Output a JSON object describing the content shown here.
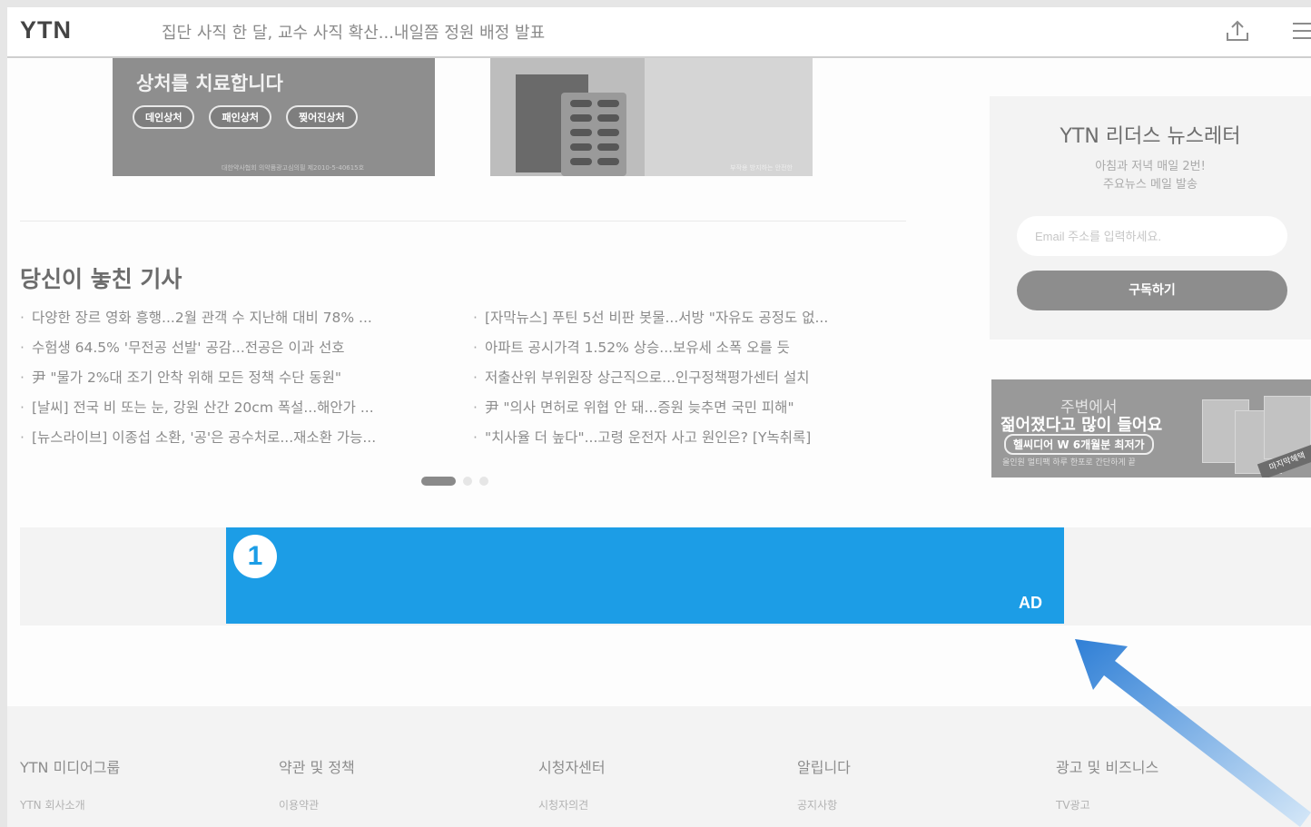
{
  "header": {
    "logo": "YTN",
    "headline": "집단 사직 한 달, 교수 사직 확산...내일쯤 정원 배정 발표",
    "share_icon": "share-upload-icon",
    "menu_icon": "hamburger-menu-icon"
  },
  "banner1": {
    "line1": "상처를 치료합니다",
    "pills": [
      "데인상처",
      "패인상처",
      "찢어진상처"
    ],
    "fine": "대한약사협회 의약품광고심의필 제2010-5-40615호"
  },
  "banner2": {
    "fine": "부작용 방지하는 안전한"
  },
  "missed": {
    "title": "당신이 놓친 기사",
    "left": [
      "다양한 장르 영화 흥행...2월 관객 수 지난해 대비 78% ...",
      "수험생 64.5% '무전공 선발' 공감...전공은 이과 선호",
      "尹 \"물가 2%대 조기 안착 위해 모든 정책 수단 동원\"",
      "[날씨] 전국 비 또는 눈, 강원 산간 20cm 폭설...해안가 ...",
      "[뉴스라이브] 이종섭 소환, '공'은 공수처로...재소환 가능..."
    ],
    "right": [
      "[자막뉴스] 푸틴 5선 비판 봇물...서방 \"자유도 공정도 없...",
      "아파트 공시가격 1.52% 상승...보유세 소폭 오를 듯",
      "저출산위 부위원장 상근직으로...인구정책평가센터 설치",
      "尹 \"의사 면허로 위협 안 돼...증원 늦추면 국민 피해\"",
      "\"치사율 더 높다\"...고령 운전자 사고 원인은? [Y녹취록]"
    ],
    "pager_active": 1,
    "pager_total": 3
  },
  "newsletter": {
    "title": "YTN 리더스 뉴스레터",
    "desc1": "아침과 저녁 매일 2번!",
    "desc2": "주요뉴스 메일 발송",
    "email_placeholder": "Email 주소를 입력하세요.",
    "subscribe_label": "구독하기"
  },
  "side_ad": {
    "line1": "주변에서",
    "line2": "젊어졌다고 많이 들어요",
    "line3": "헬씨디어 W 6개월분 최저가",
    "line4": "올인원 멀티팩 하루 한포로 간단하게 끝",
    "tag": "마지막혜택"
  },
  "ad_slot": {
    "badge": "1",
    "label": "AD"
  },
  "colors": {
    "ad_highlight": "#1c9de6",
    "arrow": "#2f7fd6"
  },
  "footer": {
    "columns": [
      {
        "title": "YTN 미디어그룹",
        "link": "YTN 회사소개"
      },
      {
        "title": "약관 및 정책",
        "link": "이용약관"
      },
      {
        "title": "시청자센터",
        "link": "시청자의견"
      },
      {
        "title": "알립니다",
        "link": "공지사항"
      },
      {
        "title": "광고 및 비즈니스",
        "link": "TV광고"
      }
    ]
  }
}
